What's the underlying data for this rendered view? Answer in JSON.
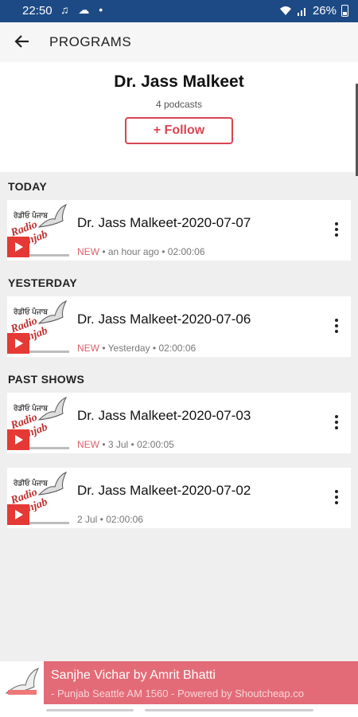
{
  "status": {
    "time": "22:50",
    "battery": "26%"
  },
  "appbar": {
    "title": "PROGRAMS"
  },
  "header": {
    "name": "Dr. Jass Malkeet",
    "count": "4 podcasts",
    "follow_label": "+ Follow"
  },
  "sections": {
    "today": "TODAY",
    "yesterday": "YESTERDAY",
    "past": "PAST SHOWS"
  },
  "episodes": [
    {
      "title": "Dr. Jass Malkeet-2020-07-07",
      "badge": "NEW",
      "meta": " • an hour ago • 02:00:06"
    },
    {
      "title": "Dr. Jass Malkeet-2020-07-06",
      "badge": "NEW",
      "meta": " • Yesterday • 02:00:06"
    },
    {
      "title": "Dr. Jass Malkeet-2020-07-03",
      "badge": "NEW",
      "meta": " • 3 Jul • 02:00:05"
    },
    {
      "title": "Dr. Jass Malkeet-2020-07-02",
      "badge": "",
      "meta": "2 Jul • 02:00:06"
    }
  ],
  "player": {
    "track": "Sanjhe Vichar by Amrit Bhatti",
    "station": "- Punjab Seattle AM 1560 - Powered by Shoutcheap.co"
  },
  "colors": {
    "status_bar": "#1d4a84",
    "accent": "#d94552",
    "player": "#e36b77"
  }
}
